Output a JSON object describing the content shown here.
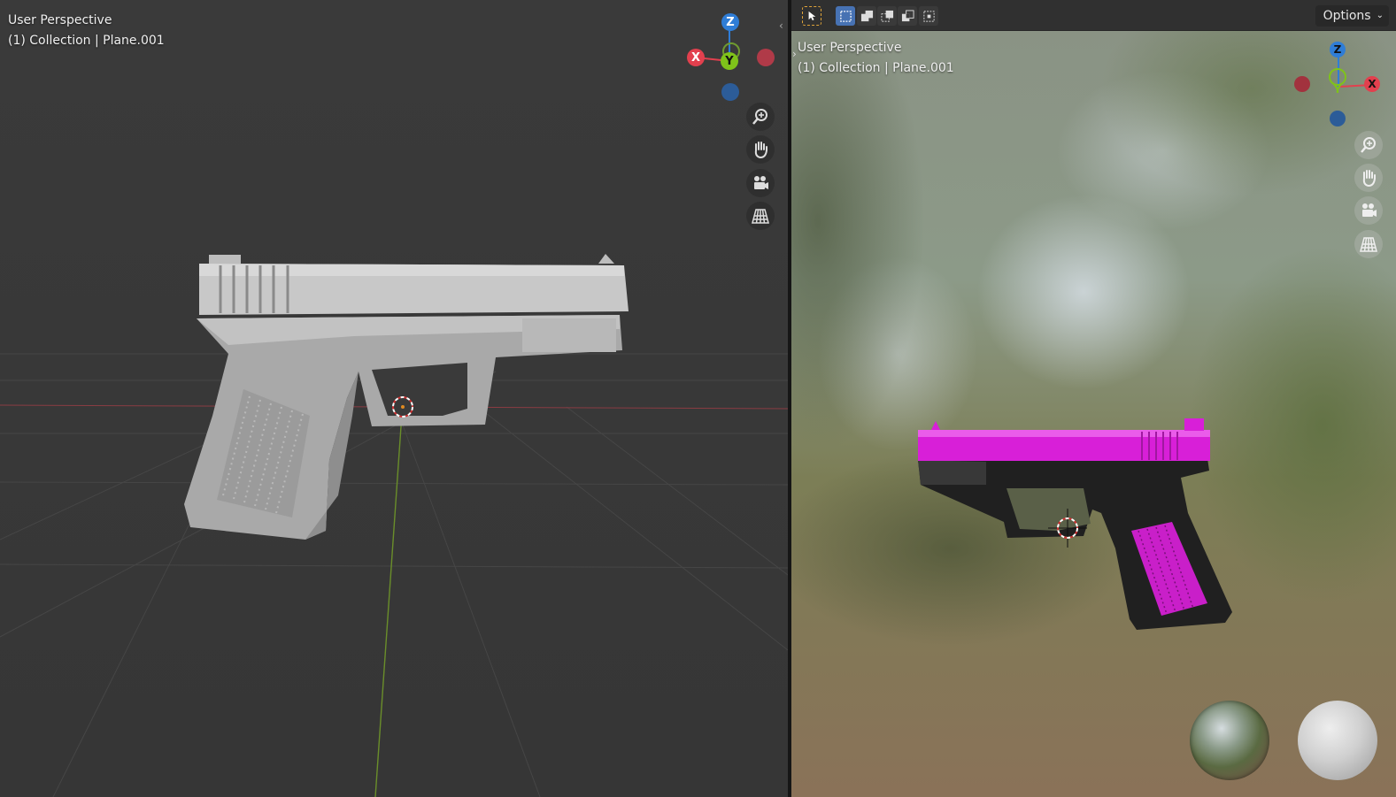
{
  "left_viewport": {
    "view_name": "User Perspective",
    "collection_label": "(1) Collection | Plane.001",
    "gizmo": {
      "z": "Z",
      "y": "Y",
      "x": "X"
    },
    "nav_icons": [
      "zoom-icon",
      "pan-hand-icon",
      "camera-icon",
      "grid-perspective-icon"
    ]
  },
  "right_viewport": {
    "view_name": "User Perspective",
    "collection_label": "(1) Collection | Plane.001",
    "gizmo": {
      "z": "Z",
      "y": "Y",
      "x": "X"
    },
    "toolbar": {
      "tools": [
        "select-cursor-icon",
        "select-box-icon",
        "select-extend-icon",
        "select-subtract-icon",
        "select-intersect-icon"
      ],
      "options_label": "Options"
    },
    "nav_icons": [
      "zoom-icon",
      "pan-hand-icon",
      "camera-icon",
      "grid-perspective-icon"
    ],
    "preview_balls": [
      "hdri-sphere",
      "diffuse-sphere"
    ]
  },
  "colors": {
    "axis_x": "#e2404e",
    "axis_y": "#7fc31a",
    "axis_z": "#2f7dd6",
    "slide_material": "#d81fd8"
  }
}
